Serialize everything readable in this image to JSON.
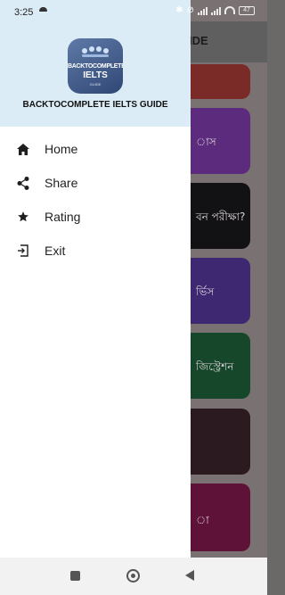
{
  "status_bar": {
    "time": "3:25",
    "battery": "47"
  },
  "background_app": {
    "title_fragment": "IDE",
    "cards": [
      {
        "text": "",
        "color": "#7a2b28"
      },
      {
        "text": "াস",
        "color": "#5d2b7d"
      },
      {
        "text": "বন পরীক্ষা?",
        "color": "#121214"
      },
      {
        "text": "র্ভিস",
        "color": "#3f2872"
      },
      {
        "text": "জিস্ট্রেশন",
        "color": "#16472b"
      },
      {
        "text": "",
        "color": "#2b1a20"
      },
      {
        "text": "া",
        "color": "#5f1238"
      }
    ]
  },
  "drawer": {
    "logo": {
      "line1": "BACKTOCOMPLETE",
      "line2": "IELTS",
      "line3": "GUIDE"
    },
    "app_name": "BACKTOCOMPLETE IELTS GUIDE",
    "menu": [
      {
        "label": "Home",
        "icon": "home-icon"
      },
      {
        "label": "Share",
        "icon": "share-icon"
      },
      {
        "label": "Rating",
        "icon": "star-icon"
      },
      {
        "label": "Exit",
        "icon": "exit-icon"
      }
    ]
  },
  "colors": {
    "drawer_header": "#dcecf6",
    "drawer_bg": "#ffffff",
    "scrim": "#7a7272"
  }
}
